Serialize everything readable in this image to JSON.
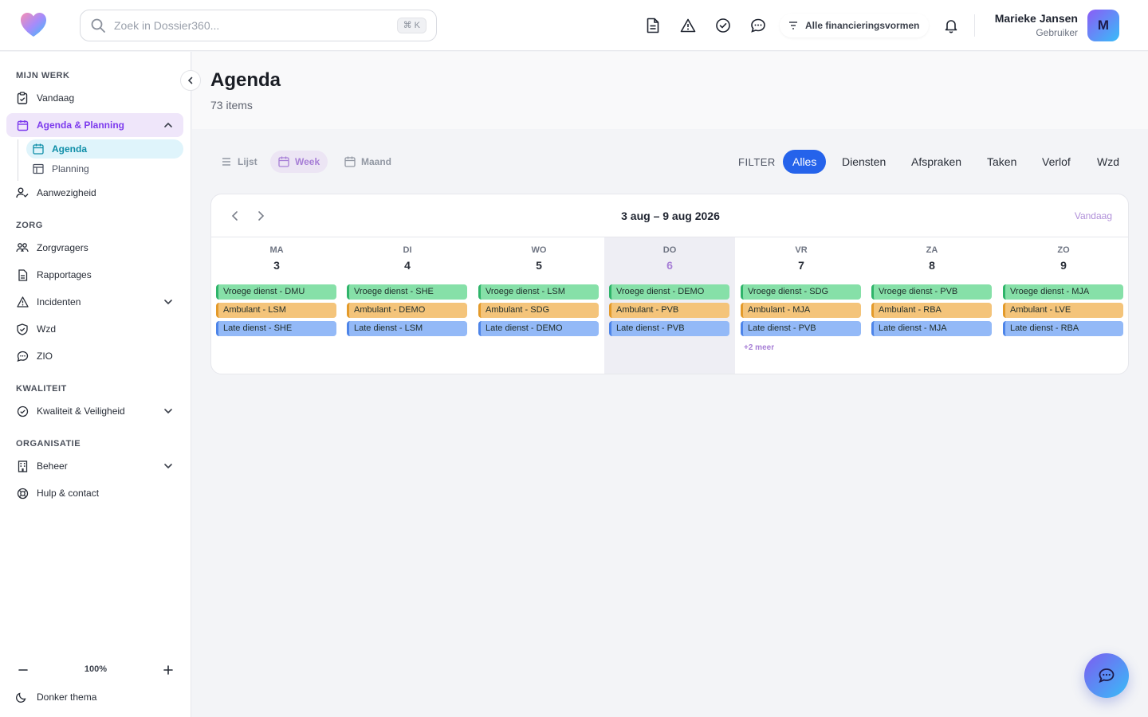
{
  "search": {
    "placeholder": "Zoek in Dossier360...",
    "shortcut": "⌘ K"
  },
  "topbar": {
    "icons": [
      "document-icon",
      "warning-icon",
      "check-circle-icon",
      "chat-icon",
      "bell-icon"
    ],
    "financing_label": "Alle financieringsvormen",
    "user_name": "Marieke Jansen",
    "user_role": "Gebruiker",
    "avatar_initial": "M"
  },
  "sidebar": {
    "sections": {
      "mijn_werk": "MIJN WERK",
      "zorg": "ZORG",
      "kwaliteit": "KWALITEIT",
      "organisatie": "ORGANISATIE"
    },
    "items": {
      "vandaag": "Vandaag",
      "agenda_planning": "Agenda & Planning",
      "agenda": "Agenda",
      "planning": "Planning",
      "aanwezigheid": "Aanwezigheid",
      "zorgvragers": "Zorgvragers",
      "rapportages": "Rapportages",
      "incidenten": "Incidenten",
      "wzd": "Wzd",
      "zio": "ZIO",
      "kwaliteit_veiligheid": "Kwaliteit & Veiligheid",
      "beheer": "Beheer",
      "hulp": "Hulp & contact"
    },
    "zoom": "100%",
    "theme_label": "Donker thema"
  },
  "page": {
    "title": "Agenda",
    "count": "73 items"
  },
  "views": {
    "list": "Lijst",
    "week": "Week",
    "month": "Maand"
  },
  "filter": {
    "label": "FILTER",
    "options": [
      "Alles",
      "Diensten",
      "Afspraken",
      "Taken",
      "Verlof",
      "Wzd"
    ],
    "selected": "Alles"
  },
  "calendar": {
    "range": "3 aug – 9 aug 2026",
    "today_label": "Vandaag",
    "days": [
      {
        "name": "MA",
        "num": "3",
        "events": [
          "Vroege dienst - DMU",
          "Ambulant - LSM",
          "Late dienst - SHE"
        ]
      },
      {
        "name": "DI",
        "num": "4",
        "events": [
          "Vroege dienst - SHE",
          "Ambulant - DEMO",
          "Late dienst - LSM"
        ]
      },
      {
        "name": "WO",
        "num": "5",
        "events": [
          "Vroege dienst - LSM",
          "Ambulant - SDG",
          "Late dienst - DEMO"
        ]
      },
      {
        "name": "DO",
        "num": "6",
        "events": [
          "Vroege dienst - DEMO",
          "Ambulant - PVB",
          "Late dienst - PVB"
        ]
      },
      {
        "name": "VR",
        "num": "7",
        "events": [
          "Vroege dienst - SDG",
          "Ambulant - MJA",
          "Late dienst - PVB"
        ],
        "more": "+2 meer"
      },
      {
        "name": "ZA",
        "num": "8",
        "events": [
          "Vroege dienst - PVB",
          "Ambulant - RBA",
          "Late dienst - MJA"
        ]
      },
      {
        "name": "ZO",
        "num": "9",
        "events": [
          "Vroege dienst - MJA",
          "Ambulant - LVE",
          "Late dienst - RBA"
        ]
      }
    ]
  },
  "colors": {
    "accent": "#7c3aed",
    "primary": "#2563eb",
    "shift_early": "#86e0a8",
    "shift_ambulant": "#f4c47a",
    "shift_late": "#93b9f7"
  }
}
